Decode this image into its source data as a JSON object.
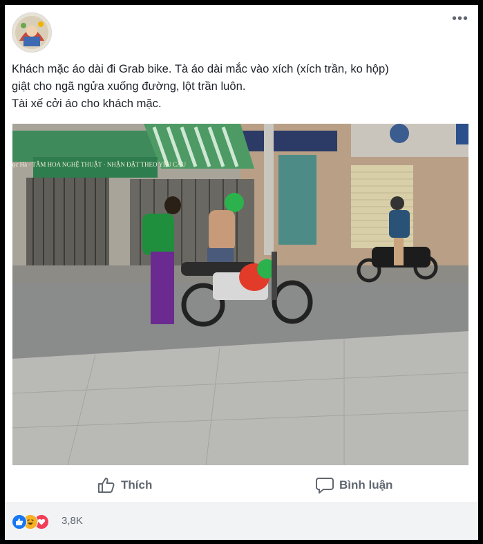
{
  "post": {
    "lines": [
      "Khách mặc áo dài đi Grab bike. Tà áo dài mắc vào xích (xích trần, ko hộp)",
      "giật cho ngã ngửa xuống đường, lột trần luôn.",
      "Tài xế cởi áo cho khách mặc."
    ],
    "more_label": "•••"
  },
  "photo": {
    "shop_sign_text": "Ngọc Hà · TÂM HOA NGHỆ THUẬT · NHẬN ĐẶT THEO YÊU CẦU"
  },
  "actions": {
    "like_label": "Thích",
    "comment_label": "Bình luận"
  },
  "reactions": {
    "count": "3,8K",
    "icons": [
      "like-icon",
      "haha-icon",
      "love-icon"
    ]
  },
  "colors": {
    "accent": "#1877f2",
    "love": "#f33e58",
    "haha": "#f7b125",
    "text": "#1d2129",
    "muted": "#606770"
  }
}
